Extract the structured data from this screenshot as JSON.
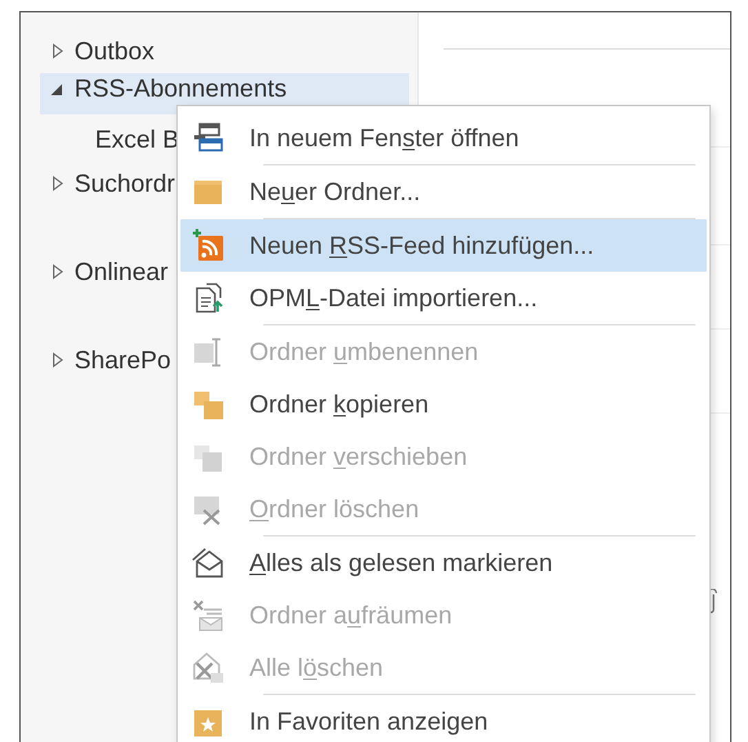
{
  "navigation": {
    "items": [
      {
        "label": "Outbox",
        "expanded": false,
        "selected": false
      },
      {
        "label": "RSS-Abonnements",
        "expanded": true,
        "selected": true,
        "children": [
          {
            "label": "Excel B",
            "selected": false
          }
        ]
      },
      {
        "label": "Suchordr",
        "expanded": false,
        "selected": false
      },
      {
        "label": "Onlinear",
        "expanded": false,
        "selected": false
      },
      {
        "label": "SharePo",
        "expanded": false,
        "selected": false
      }
    ]
  },
  "context_menu": {
    "items": [
      {
        "before": "In neuem Fen",
        "key": "s",
        "after": "ter öffnen",
        "disabled": false,
        "selected": false,
        "separator_after": true
      },
      {
        "before": "Ne",
        "key": "u",
        "after": "er Ordner...",
        "disabled": false,
        "selected": false,
        "separator_after": true
      },
      {
        "before": "Neuen ",
        "key": "R",
        "after": "SS-Feed hinzufügen...",
        "disabled": false,
        "selected": true,
        "separator_after": false
      },
      {
        "before": "OPM",
        "key": "L",
        "after": "-Datei importieren...",
        "disabled": false,
        "selected": false,
        "separator_after": true
      },
      {
        "before": "Ordner ",
        "key": "u",
        "after": "mbenennen",
        "disabled": true,
        "selected": false,
        "separator_after": false
      },
      {
        "before": "Ordner ",
        "key": "k",
        "after": "opieren",
        "disabled": false,
        "selected": false,
        "separator_after": false
      },
      {
        "before": "Ordner ",
        "key": "v",
        "after": "erschieben",
        "disabled": true,
        "selected": false,
        "separator_after": false
      },
      {
        "key": "O",
        "after": "rdner löschen",
        "disabled": true,
        "selected": false,
        "separator_after": true
      },
      {
        "key": "A",
        "after": "lles als gelesen markieren",
        "disabled": false,
        "selected": false,
        "separator_after": false
      },
      {
        "before": "Ordner a",
        "key": "u",
        "after": "fräumen",
        "disabled": true,
        "selected": false,
        "separator_after": false
      },
      {
        "before": "Alle l",
        "key": "ö",
        "after": "schen",
        "disabled": true,
        "selected": false,
        "separator_after": true
      },
      {
        "before": "In Favoriten anzeigen",
        "disabled": false,
        "selected": false,
        "separator_after": false
      }
    ]
  }
}
